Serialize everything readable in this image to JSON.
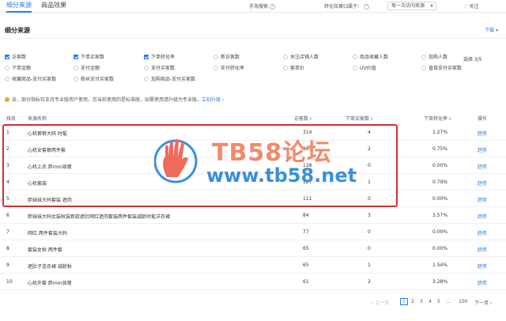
{
  "tabs": [
    {
      "label": "细分来源",
      "active": true
    },
    {
      "label": "商品效果",
      "active": false
    }
  ],
  "topbar": {
    "search_label": "手淘搜索",
    "attribution_label": "转化效果归属于：",
    "attribution_value": "每一次访问来源",
    "follow_label": "关注"
  },
  "section": {
    "title": "细分来源",
    "download_label": "下载"
  },
  "metric_options": [
    {
      "label": "访客数",
      "checked": true
    },
    {
      "label": "下单买家数",
      "checked": true
    },
    {
      "label": "下单转化率",
      "checked": true
    },
    {
      "label": "新访客数",
      "checked": false
    },
    {
      "label": "关注店铺人数",
      "checked": false
    },
    {
      "label": "商品收藏人数",
      "checked": false
    },
    {
      "label": "加购人数",
      "checked": false
    },
    {
      "label": "下单金额",
      "checked": false
    },
    {
      "label": "支付金额",
      "checked": false
    },
    {
      "label": "支付买家数",
      "checked": false
    },
    {
      "label": "支付转化率",
      "checked": false
    },
    {
      "label": "客单价",
      "checked": false
    },
    {
      "label": "UV价值",
      "checked": false
    },
    {
      "label": "直接支付买家数",
      "checked": false
    },
    {
      "label": "收藏商品-支付买家数",
      "checked": false
    },
    {
      "label": "粉丝支付买家数",
      "checked": false
    },
    {
      "label": "加购商品-支付买家数",
      "checked": false
    }
  ],
  "selection_count": "选择 3/5",
  "notice": {
    "text": "亲，部分指标仅支持专业版用户使用，您当前使用的是标准版，如需使用请升级为专业版。",
    "link": "立刻升级 ›"
  },
  "table": {
    "headers": {
      "rank": "排名",
      "source": "来源名称",
      "visitors": "访客数",
      "buyers": "下单买家数",
      "conversion": "下单转化率",
      "action": "操作"
    },
    "rows": [
      {
        "rank": "1",
        "source": "心机裤裤大码 时髦",
        "visitors": "314",
        "buyers": "4",
        "conversion": "1.27%",
        "action": "趋势"
      },
      {
        "rank": "2",
        "source": "心机女套裤两件套",
        "visitors": "265",
        "buyers": "2",
        "conversion": "0.75%",
        "action": "趋势"
      },
      {
        "rank": "3",
        "source": "心机上衣 胖mm显瘦",
        "visitors": "128",
        "buyers": "0",
        "conversion": "0.00%",
        "action": "趋势"
      },
      {
        "rank": "4",
        "source": "心机套装",
        "visitors": "127",
        "buyers": "1",
        "conversion": "0.79%",
        "action": "趋势"
      },
      {
        "rank": "5",
        "source": "胖妹妹大码套装 遮肉",
        "visitors": "111",
        "buyers": "0",
        "conversion": "0.00%",
        "action": "趋势"
      },
      {
        "rank": "6",
        "source": "胖妹妹大码女装秋装新款遮肚网红遮肉套装两件套装减龄时髦洋衣裙",
        "visitors": "84",
        "buyers": "3",
        "conversion": "3.57%",
        "action": "趋势"
      },
      {
        "rank": "7",
        "source": "网红 两件套装大码",
        "visitors": "77",
        "buyers": "0",
        "conversion": "0.00%",
        "action": "趋势"
      },
      {
        "rank": "8",
        "source": "套装女秋 两件套",
        "visitors": "65",
        "buyers": "0",
        "conversion": "0.00%",
        "action": "趋势"
      },
      {
        "rank": "9",
        "source": "遮肚子连衣裙 减龄秋",
        "visitors": "65",
        "buyers": "1",
        "conversion": "1.54%",
        "action": "趋势"
      },
      {
        "rank": "10",
        "source": "心机外套 胖mm显瘦",
        "visitors": "61",
        "buyers": "2",
        "conversion": "3.28%",
        "action": "趋势"
      }
    ]
  },
  "pagination": {
    "prev": "‹ 上一页",
    "pages": [
      "1",
      "2",
      "3",
      "4",
      "5",
      "...",
      "100"
    ],
    "current": "1",
    "next": "下一页 ›"
  },
  "watermark": {
    "title": "TB58论坛",
    "url": "www.tb58.net"
  },
  "colors": {
    "accent": "#2c7be5",
    "highlight": "#d32f2f",
    "warning": "#f5a623"
  }
}
